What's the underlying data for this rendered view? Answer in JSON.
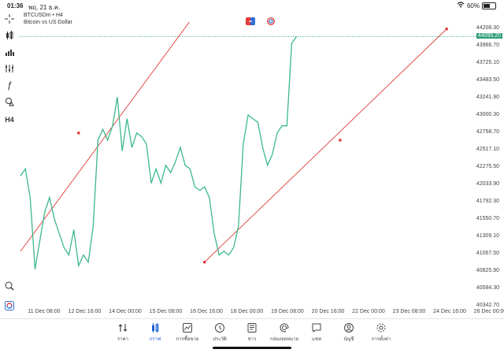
{
  "status_bar": {
    "time": "01:36",
    "date": "พฤ. 21 ธ.ค.",
    "battery": "60%",
    "battery_level": 0.6
  },
  "symbol": {
    "name": "BTCUSDm • H4",
    "description": "Bitcoin vs US Dollar"
  },
  "toolbar": {
    "timeframe_label": "H4",
    "fx_label": "ƒ"
  },
  "price_axis": {
    "ticks": [
      "44208.30",
      "43966.70",
      "43725.10",
      "43483.50",
      "43241.90",
      "43000.30",
      "42758.70",
      "42517.10",
      "42275.50",
      "42033.90",
      "41792.30",
      "41550.70",
      "41309.10",
      "41067.50",
      "40825.90",
      "40584.30",
      "40342.70"
    ],
    "current": "44095.20"
  },
  "time_axis": {
    "ticks": [
      "11 Dec 08:00",
      "12 Dec 16:00",
      "14 Dec 00:00",
      "15 Dec 08:00",
      "16 Dec 16:00",
      "18 Dec 00:00",
      "19 Dec 08:00",
      "20 Dec 16:00",
      "22 Dec 00:00",
      "23 Dec 08:00",
      "24 Dec 16:00",
      "26 Dec 00:00"
    ]
  },
  "bottom_nav": [
    {
      "label": "ราคา",
      "icon": "quotes-icon"
    },
    {
      "label": "กราฟ",
      "icon": "chart-icon",
      "active": true
    },
    {
      "label": "การซื้อขาย",
      "icon": "trade-icon"
    },
    {
      "label": "ประวัติ",
      "icon": "history-icon"
    },
    {
      "label": "ข่าว",
      "icon": "news-icon"
    },
    {
      "label": "กล่องจดหมาย",
      "icon": "mailbox-icon"
    },
    {
      "label": "แชท",
      "icon": "chat-icon"
    },
    {
      "label": "บัญชี",
      "icon": "account-icon"
    },
    {
      "label": "การตั้งค่า",
      "icon": "settings-icon"
    }
  ],
  "colors": {
    "line": "#3cb88a",
    "trendline": "#e03a3a",
    "active": "#1a5fd0",
    "current_price_bg": "#2e9d7a"
  },
  "chart_data": {
    "type": "line",
    "ylim": [
      40342.7,
      44208.3
    ],
    "x": [
      0,
      1,
      2,
      3,
      4,
      5,
      6,
      7,
      8,
      9,
      10,
      11,
      12,
      13,
      14,
      15,
      16,
      17,
      18,
      19,
      20,
      21,
      22,
      23,
      24,
      25,
      26,
      27,
      28,
      29,
      30,
      31,
      32,
      33,
      34,
      35,
      36,
      37,
      38,
      39,
      40,
      41,
      42,
      43,
      44,
      45,
      46,
      47,
      48,
      49,
      50,
      51,
      52,
      53,
      54,
      55,
      56,
      57,
      58,
      59,
      60,
      61
    ],
    "values": [
      42150,
      42250,
      41850,
      40850,
      41250,
      41650,
      41850,
      41550,
      41350,
      41150,
      41050,
      41400,
      40900,
      41050,
      40950,
      41450,
      42650,
      42800,
      42650,
      42850,
      43250,
      42500,
      42950,
      42550,
      42750,
      42700,
      42600,
      42050,
      42250,
      42050,
      42300,
      42200,
      42350,
      42550,
      42300,
      42250,
      42000,
      41950,
      42000,
      41850,
      41350,
      41050,
      41100,
      41050,
      41150,
      41450,
      42600,
      43000,
      42950,
      42900,
      42550,
      42300,
      42450,
      42750,
      42850,
      42850,
      44000,
      44095
    ],
    "xlabel": "",
    "ylabel": "",
    "trendlines": [
      {
        "points": [
          [
            12,
            42750
          ]
        ],
        "line": [
          [
            0,
            41100
          ],
          [
            36,
            44400
          ]
        ]
      },
      {
        "points": [
          [
            38,
            40950
          ],
          [
            66,
            42650
          ]
        ],
        "line": [
          [
            38,
            40950
          ],
          [
            88,
            44200
          ]
        ]
      }
    ]
  }
}
